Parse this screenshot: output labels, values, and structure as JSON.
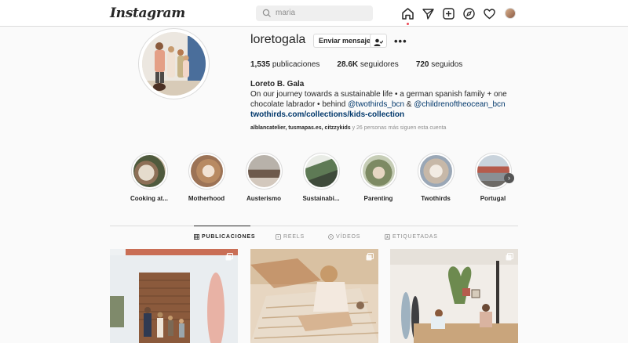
{
  "nav": {
    "logo": "Instagram",
    "search_value": "maria"
  },
  "profile": {
    "username": "loretogala",
    "message_button": "Enviar mensaje",
    "stats": {
      "posts_count": "1,535",
      "posts_label": "publicaciones",
      "followers_count": "28.6K",
      "followers_label": "seguidores",
      "following_count": "720",
      "following_label": "seguidos"
    },
    "bio": {
      "name": "Loreto B. Gala",
      "line1": "On our journey towards a sustainable life • a german spanish family + one chocolate",
      "line2_prefix": "labrador • behind ",
      "tag1": "@twothirds_bcn",
      "amp": " & ",
      "tag2": "@childrenoftheocean_bcn",
      "link": "twothirds.com/collections/kids-collection"
    },
    "followed_by": {
      "names": "alblancatelier, tusmapas.es, citzzykids",
      "suffix": " y 26 personas más siguen esta cuenta"
    }
  },
  "highlights": [
    {
      "label": "Cooking at..."
    },
    {
      "label": "Motherhood"
    },
    {
      "label": "Austerismo"
    },
    {
      "label": "Sustainabi..."
    },
    {
      "label": "Parenting"
    },
    {
      "label": "Twothirds"
    },
    {
      "label": "Portugal"
    }
  ],
  "tabs": [
    {
      "label": "PUBLICACIONES",
      "icon": "grid-icon"
    },
    {
      "label": "REELS",
      "icon": "reels-icon"
    },
    {
      "label": "VÍDEOS",
      "icon": "video-icon"
    },
    {
      "label": "ETIQUETADAS",
      "icon": "tagged-icon"
    }
  ],
  "colors": {
    "accent_dot": "#ed4956",
    "link": "#00376b"
  }
}
